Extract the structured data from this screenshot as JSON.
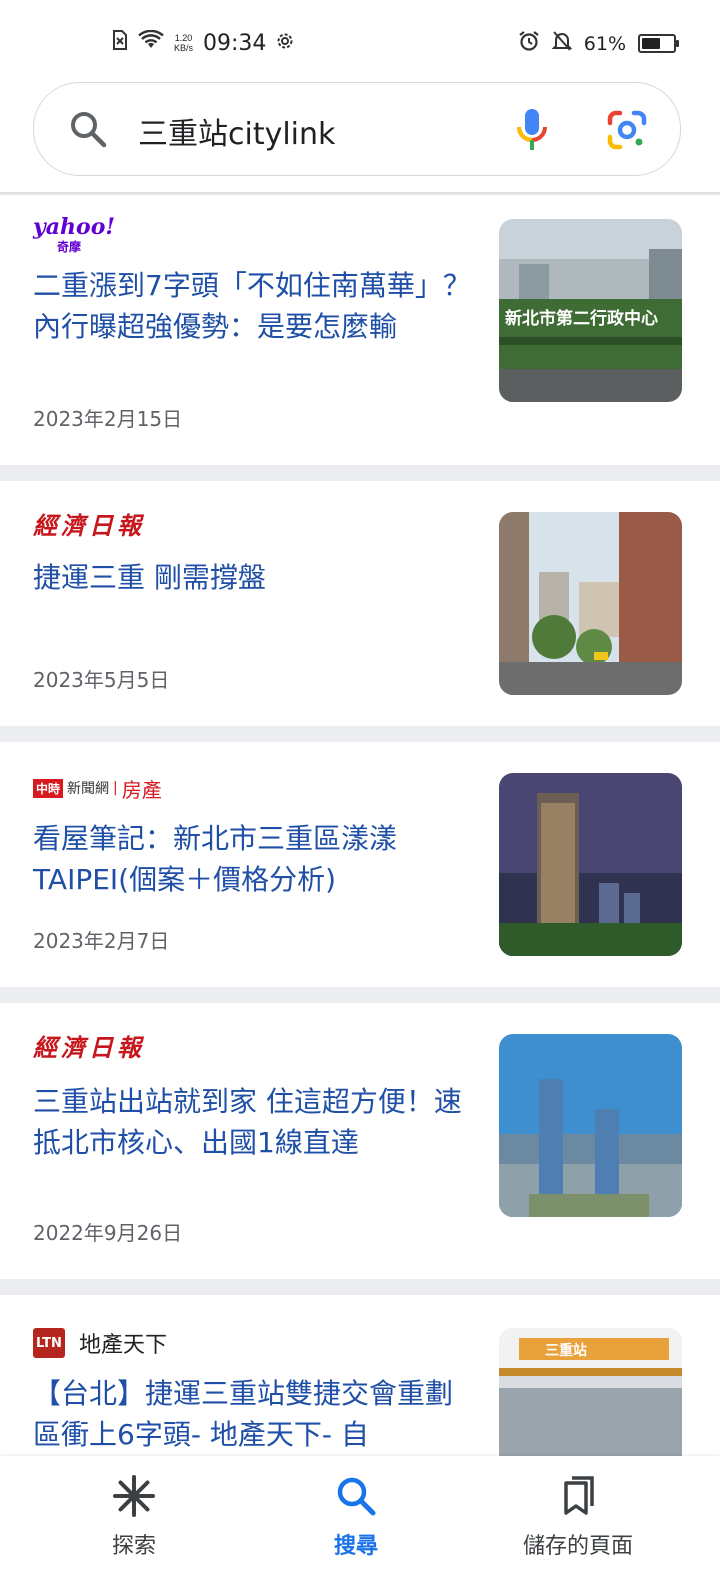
{
  "status_bar": {
    "speed_top": "1.20",
    "speed_bottom": "KB/s",
    "time": "09:34",
    "battery": "61%",
    "battery_level": 0.61,
    "icons": [
      "sim-off-icon",
      "wifi-icon",
      "settings-icon",
      "alarm-icon",
      "mute-icon",
      "battery-icon"
    ]
  },
  "search": {
    "query": "三重站citylink",
    "icons": [
      "search-icon",
      "mic-icon",
      "lens-icon"
    ]
  },
  "results": [
    {
      "source": "yahoo!",
      "source_sub": "奇摩",
      "title": "二重漲到7字頭「不如住南萬華」？內行曝超強優勢：是要怎麼輸",
      "date": "2023年2月15日",
      "thumb": "新北市第二行政中心"
    },
    {
      "source": "經濟日報",
      "title": "捷運三重 剛需撐盤",
      "date": "2023年5月5日"
    },
    {
      "source": "中時",
      "source_mid": "新聞網",
      "source_sub": "房產",
      "title": "看屋筆記：新北市三重區漾漾TAIPEI(個案＋價格分析)",
      "date": "2023年2月7日"
    },
    {
      "source": "經濟日報",
      "title": "三重站出站就到家 住這超方便！速抵北市核心、出國1線直達",
      "date": "2022年9月26日"
    },
    {
      "source_badge": "LTN",
      "source": "地產天下",
      "title": "【台北】捷運三重站雙捷交會重劃區衝上6字頭- 地產天下- 自",
      "thumb": "三重站"
    }
  ],
  "bottom_nav": [
    {
      "label": "探索",
      "icon": "asterisk-icon",
      "active": false
    },
    {
      "label": "搜尋",
      "icon": "search-icon",
      "active": true
    },
    {
      "label": "儲存的頁面",
      "icon": "bookmarks-icon",
      "active": false
    }
  ]
}
